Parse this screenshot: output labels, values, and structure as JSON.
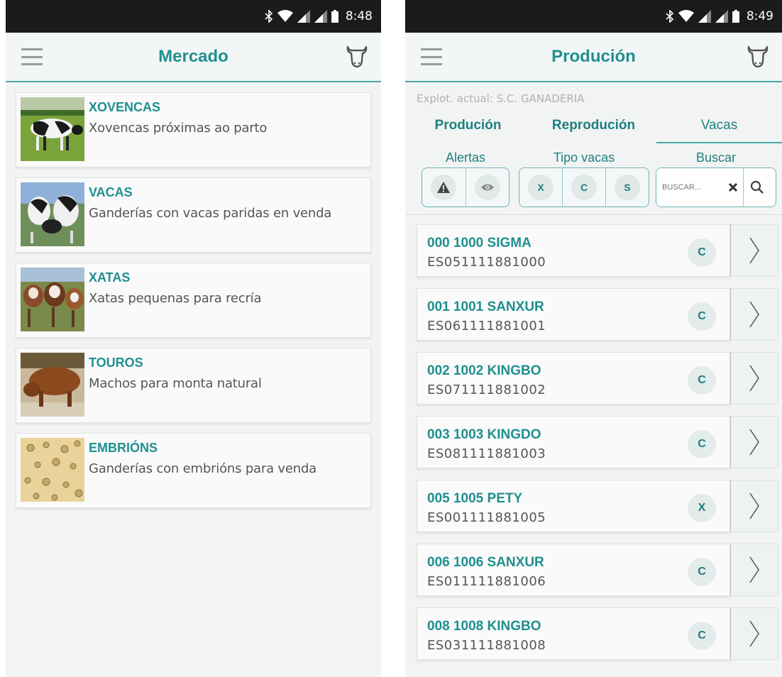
{
  "left_screen": {
    "status": {
      "time": "8:48"
    },
    "appbar": {
      "title": "Mercado"
    },
    "items": [
      {
        "title": "XOVENCAS",
        "subtitle": "Xovencas próximas ao parto"
      },
      {
        "title": "VACAS",
        "subtitle": "Ganderías con vacas paridas en venda"
      },
      {
        "title": "XATAS",
        "subtitle": "Xatas pequenas para recría"
      },
      {
        "title": "TOUROS",
        "subtitle": "Machos para monta natural"
      },
      {
        "title": "EMBRIÓNS",
        "subtitle": "Ganderías con embrións para venda"
      }
    ]
  },
  "right_screen": {
    "status": {
      "time": "8:49"
    },
    "appbar": {
      "title": "Produción"
    },
    "explot": "Explot. actual: S.C. GANADERIA",
    "tabs": [
      {
        "label": "Produción"
      },
      {
        "label": "Reprodución"
      },
      {
        "label": "Vacas",
        "active": true
      }
    ],
    "filters": {
      "alerts_label": "Alertas",
      "type_label": "Tipo vacas",
      "type_buttons": [
        "X",
        "C",
        "S"
      ],
      "search_label": "Buscar",
      "search_placeholder": "BUSCAR..."
    },
    "cows": [
      {
        "name": "000 1000 SIGMA",
        "code": "ES051111881000",
        "type": "C"
      },
      {
        "name": "001 1001 SANXUR",
        "code": "ES061111881001",
        "type": "C"
      },
      {
        "name": "002 1002 KINGBO",
        "code": "ES071111881002",
        "type": "C"
      },
      {
        "name": "003 1003 KINGDO",
        "code": "ES081111881003",
        "type": "C"
      },
      {
        "name": "005 1005 PETY",
        "code": "ES001111881005",
        "type": "X"
      },
      {
        "name": "006 1006 SANXUR",
        "code": "ES011111881006",
        "type": "C"
      },
      {
        "name": "008 1008 KINGBO",
        "code": "ES031111881008",
        "type": "C"
      }
    ]
  },
  "colors": {
    "accent": "#1f8f8f",
    "divider": "#4aa6a6",
    "statusbar": "#1b1b1b"
  },
  "icons": [
    "bluetooth-icon",
    "wifi-icon",
    "signal-icon",
    "battery-icon",
    "menu-icon",
    "cow-head-icon",
    "warning-icon",
    "eye-icon",
    "close-icon",
    "search-icon",
    "chevron-right-icon"
  ]
}
